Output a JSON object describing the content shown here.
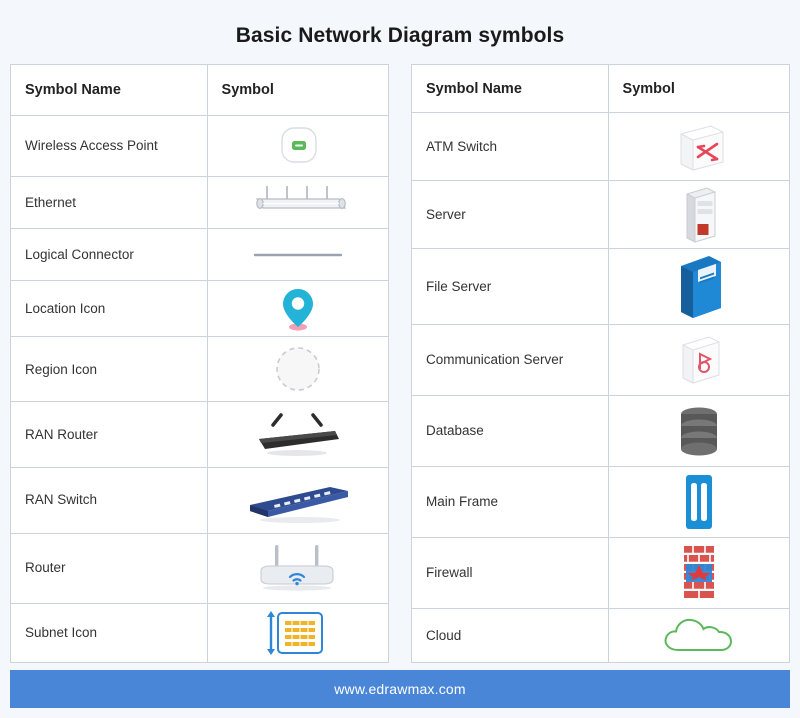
{
  "title": "Basic Network Diagram symbols",
  "colors": {
    "page_bg": "#f4f7fb",
    "footer_bg": "#4a86d8",
    "grid_line": "#ccd3dd",
    "accent_blue": "#1a78c2",
    "accent_green": "#4caf50",
    "accent_red": "#e03a3a"
  },
  "left_table": {
    "headers": [
      "Symbol Name",
      "Symbol"
    ],
    "rows": [
      {
        "name": "Wireless Access Point",
        "icon": "wireless-access-point-icon"
      },
      {
        "name": "Ethernet",
        "icon": "ethernet-bus-icon"
      },
      {
        "name": "Logical Connector",
        "icon": "logical-connector-icon"
      },
      {
        "name": "Location Icon",
        "icon": "location-pin-icon"
      },
      {
        "name": "Region Icon",
        "icon": "region-dashed-circle-icon"
      },
      {
        "name": "RAN Router",
        "icon": "ran-router-icon"
      },
      {
        "name": "RAN Switch",
        "icon": "ran-switch-icon"
      },
      {
        "name": "Router",
        "icon": "router-icon"
      },
      {
        "name": "Subnet Icon",
        "icon": "subnet-icon"
      }
    ]
  },
  "right_table": {
    "headers": [
      "Symbol Name",
      "Symbol"
    ],
    "rows": [
      {
        "name": "ATM Switch",
        "icon": "atm-switch-icon"
      },
      {
        "name": "Server",
        "icon": "server-icon"
      },
      {
        "name": "File Server",
        "icon": "file-server-icon"
      },
      {
        "name": "Communication Server",
        "icon": "communication-server-icon"
      },
      {
        "name": "Database",
        "icon": "database-icon"
      },
      {
        "name": "Main Frame",
        "icon": "main-frame-icon"
      },
      {
        "name": "Firewall",
        "icon": "firewall-icon"
      },
      {
        "name": "Cloud",
        "icon": "cloud-icon"
      }
    ]
  },
  "footer": {
    "url": "www.edrawmax.com"
  }
}
